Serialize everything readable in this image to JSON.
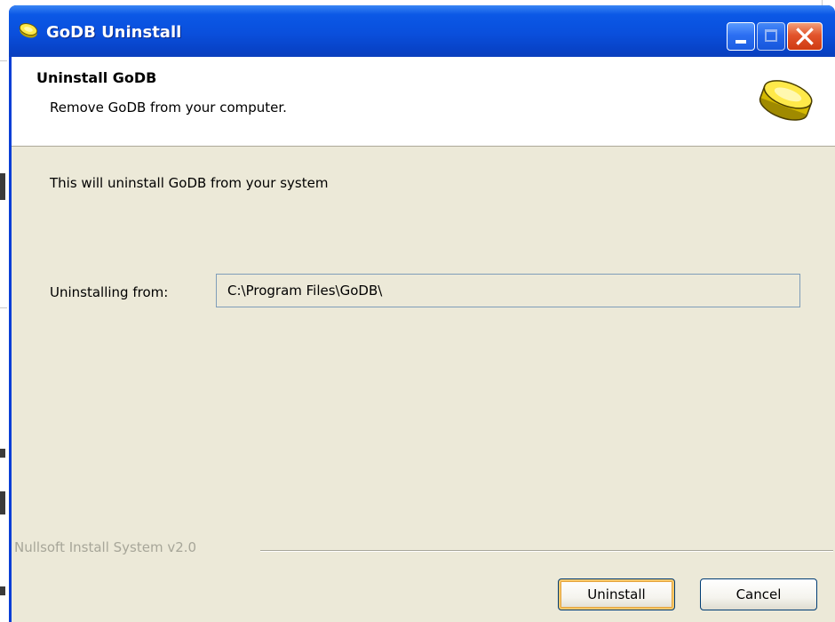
{
  "window": {
    "title": "GoDB Uninstall",
    "icon": "godb-disk-icon",
    "controls": {
      "minimize": "minimize-icon",
      "maximize": "maximize-icon",
      "close": "close-icon"
    }
  },
  "header": {
    "title": "Uninstall GoDB",
    "subtitle": "Remove GoDB from your computer.",
    "icon": "godb-disk-icon"
  },
  "main": {
    "message": "This will uninstall GoDB from your system",
    "path_label": "Uninstalling from:",
    "path_value": "C:\\Program Files\\GoDB\\"
  },
  "footer": {
    "branding": "Nullsoft Install System v2.0",
    "uninstall_label": "Uninstall",
    "cancel_label": "Cancel"
  },
  "colors": {
    "titlebar": "#0a4fdc",
    "close_button": "#e2542b",
    "dialog_background": "#ece9d8",
    "default_button_highlight": "#f6c86b"
  }
}
